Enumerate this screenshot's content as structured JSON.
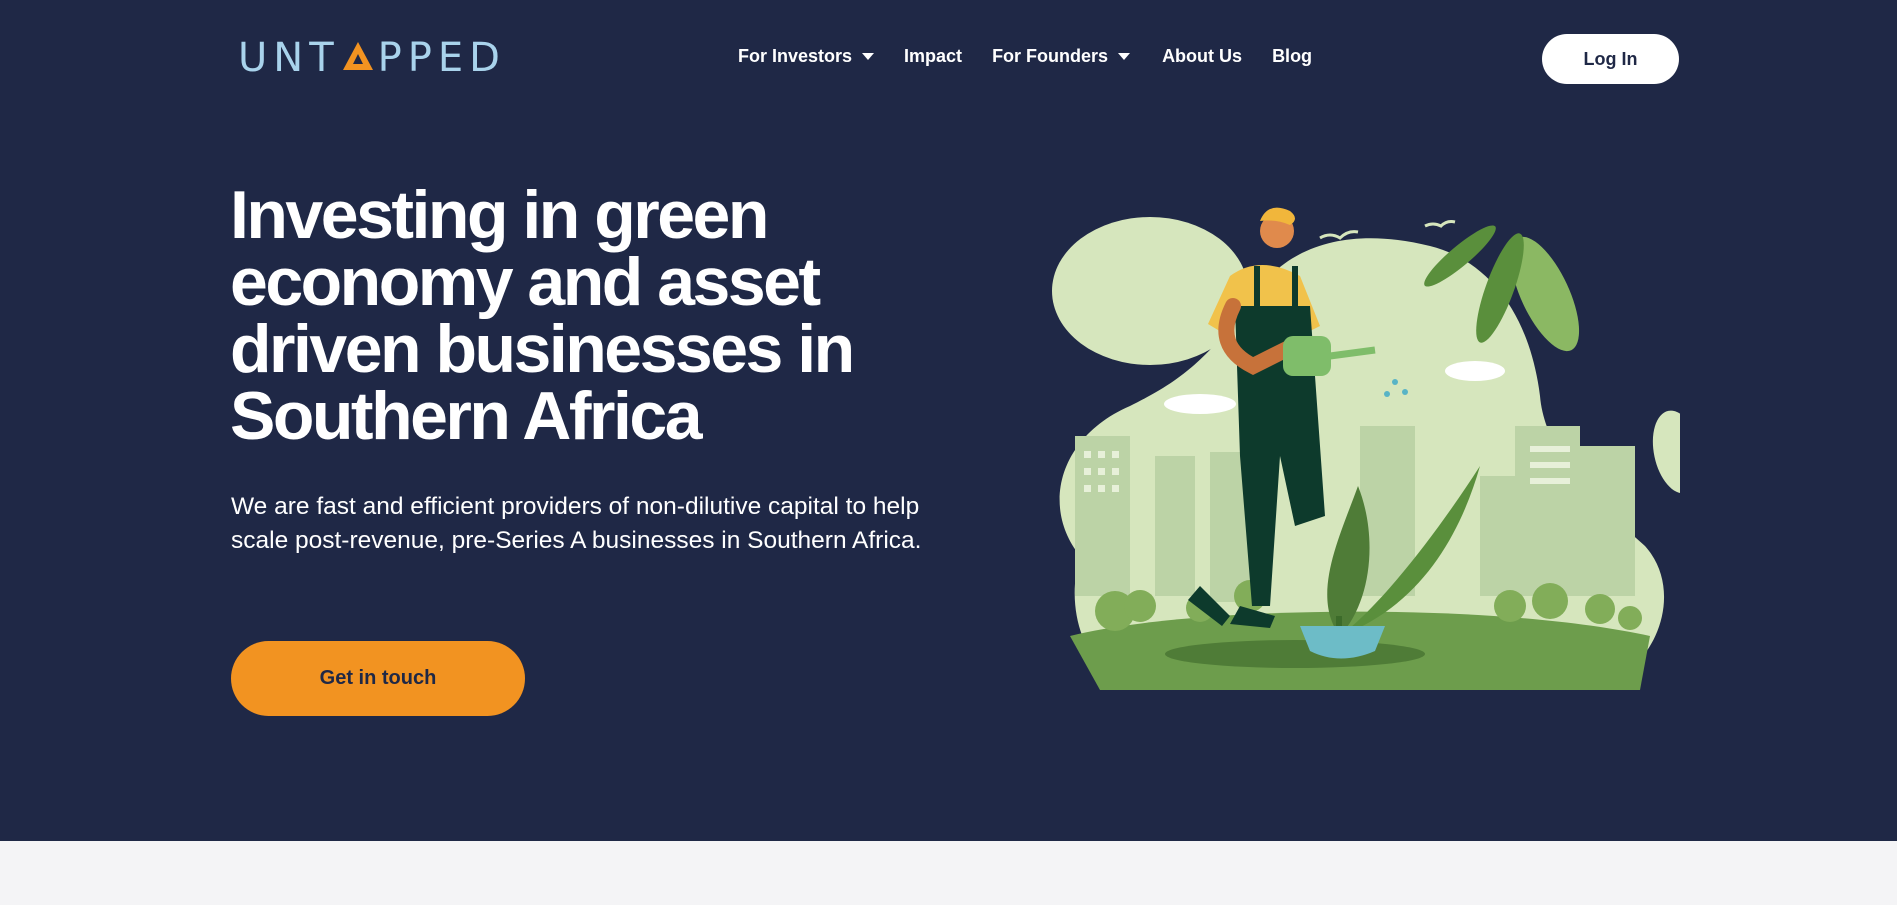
{
  "brand": {
    "logo_text_left": "UNT",
    "logo_text_right": "PPED",
    "logo_accent_color": "#f29321",
    "logo_color": "#a9d3ec"
  },
  "nav": {
    "items": [
      {
        "label": "For Investors",
        "has_dropdown": true
      },
      {
        "label": "Impact",
        "has_dropdown": false
      },
      {
        "label": "For Founders",
        "has_dropdown": true
      },
      {
        "label": "About Us",
        "has_dropdown": false
      },
      {
        "label": "Blog",
        "has_dropdown": false
      }
    ],
    "login_label": "Log In"
  },
  "hero": {
    "headline_lines": [
      "Investing in green",
      "economy and asset",
      "driven businesses in",
      "Southern Africa"
    ],
    "subtitle": "We are fast and efficient providers of non-dilutive capital to help scale post-revenue, pre-Series A businesses in Southern Africa.",
    "cta_label": "Get in touch",
    "illustration": "man-watering-plant-icon"
  },
  "colors": {
    "background": "#1f2846",
    "accent": "#f29321",
    "below_section": "#f4f4f6"
  }
}
